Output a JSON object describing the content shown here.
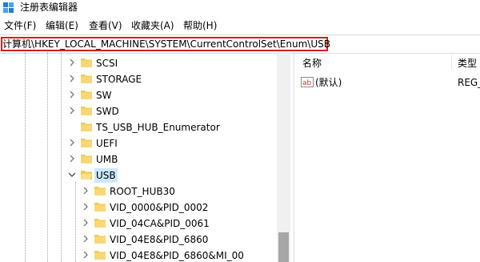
{
  "window": {
    "title": "注册表编辑器"
  },
  "menu": [
    "文件(F)",
    "编辑(E)",
    "查看(V)",
    "收藏夹(A)",
    "帮助(H)"
  ],
  "address": "计算机\\HKEY_LOCAL_MACHINE\\SYSTEM\\CurrentControlSet\\Enum\\USB",
  "tree": [
    {
      "label": "SCSI",
      "expanded": false,
      "selected": false
    },
    {
      "label": "STORAGE",
      "expanded": false,
      "selected": false
    },
    {
      "label": "SW",
      "expanded": false,
      "selected": false
    },
    {
      "label": "SWD",
      "expanded": false,
      "selected": false
    },
    {
      "label": "TS_USB_HUB_Enumerator",
      "expanded": false,
      "selected": false
    },
    {
      "label": "UEFI",
      "expanded": false,
      "selected": false
    },
    {
      "label": "UMB",
      "expanded": false,
      "selected": false
    },
    {
      "label": "USB",
      "expanded": true,
      "selected": true
    },
    {
      "label": "ROOT_HUB30",
      "expanded": false,
      "selected": false
    },
    {
      "label": "VID_0000&PID_0002",
      "expanded": false,
      "selected": false
    },
    {
      "label": "VID_04CA&PID_0061",
      "expanded": false,
      "selected": false
    },
    {
      "label": "VID_04E8&PID_6860",
      "expanded": false,
      "selected": false
    },
    {
      "label": "VID_04E8&PID_6860&MI_00",
      "expanded": false,
      "selected": false
    }
  ],
  "columns": {
    "name": "名称",
    "type": "类型"
  },
  "values": [
    {
      "name": "(默认)",
      "type": "REG_"
    }
  ],
  "colors": {
    "highlight_border": "#d81e1e",
    "selection": "#cce8ff",
    "folder": "#f3c84b"
  }
}
